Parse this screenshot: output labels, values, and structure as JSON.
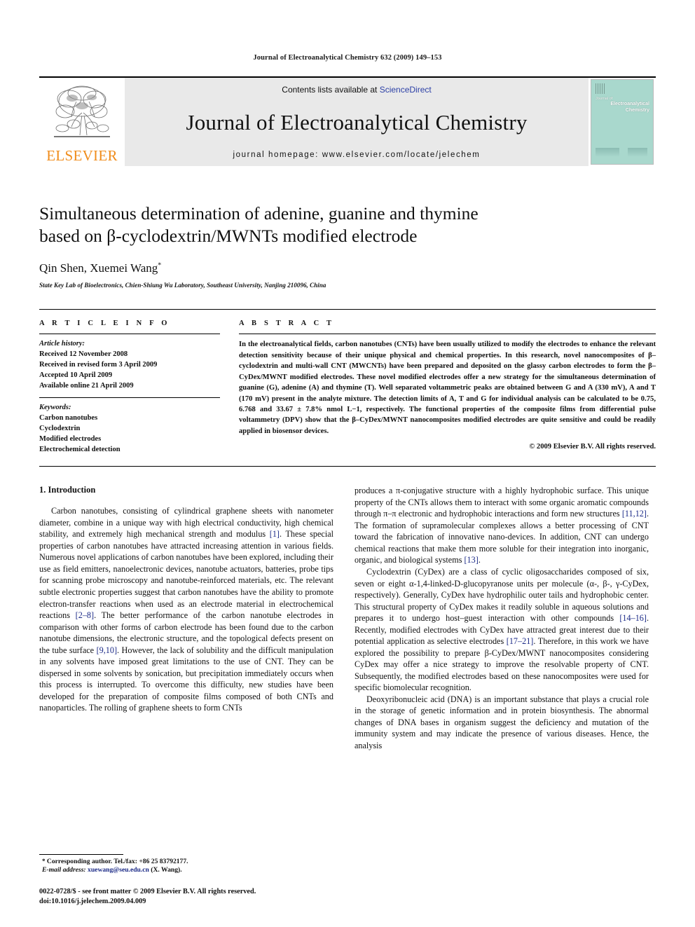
{
  "running_head": "Journal of Electroanalytical Chemistry 632 (2009) 149–153",
  "masthead": {
    "publisher_wordmark": "ELSEVIER",
    "contents_prefix": "Contents lists available at ",
    "contents_link": "ScienceDirect",
    "journal_title": "Journal of Electroanalytical Chemistry",
    "homepage_line": "journal homepage: www.elsevier.com/locate/jelechem",
    "cover": {
      "line1": "Journal of",
      "line2": "Electroanalytical",
      "line3": "Chemistry",
      "accent_color": "#a9d8cd"
    },
    "accent_color_elsevier": "#F08C1B",
    "link_color": "#2b3fa6",
    "panel_bg": "#e9e9e9"
  },
  "article": {
    "title_line_1": "Simultaneous determination of adenine, guanine and thymine",
    "title_line_2": "based on β-cyclodextrin/MWNTs modified electrode",
    "authors": "Qin Shen, Xuemei Wang",
    "corresponding_marker": "*",
    "affiliation": "State Key Lab of Bioelectronics, Chien-Shiung Wu Laboratory, Southeast University, Nanjing 210096, China"
  },
  "article_info": {
    "heading": "A R T I C L E   I N F O",
    "history_label": "Article history:",
    "history": [
      "Received 12 November 2008",
      "Received in revised form 3 April 2009",
      "Accepted 10 April 2009",
      "Available online 21 April 2009"
    ],
    "keywords_label": "Keywords:",
    "keywords": [
      "Carbon nanotubes",
      "Cyclodextrin",
      "Modified electrodes",
      "Electrochemical detection"
    ]
  },
  "abstract": {
    "heading": "A B S T R A C T",
    "text": "In the electroanalytical fields, carbon nanotubes (CNTs) have been usually utilized to modify the electrodes to enhance the relevant detection sensitivity because of their unique physical and chemical properties. In this research, novel nanocomposites of β–cyclodextrin and multi-wall CNT (MWCNTs) have been prepared and deposited on the glassy carbon electrodes to form the β–CyDex/MWNT modified electrodes. These novel modified electrodes offer a new strategy for the simultaneous determination of guanine (G), adenine (A) and thymine (T). Well separated voltammetric peaks are obtained between G and A (330 mV), A and T (170 mV) present in the analyte mixture. The detection limits of A, T and G for individual analysis can be calculated to be 0.75, 6.768 and 33.67 ± 7.8% nmol L−1, respectively. The functional properties of the composite films from differential pulse voltammetry (DPV) show that the β–CyDex/MWNT nanocomposites modified electrodes are quite sensitive and could be readily applied in biosensor devices.",
    "copyright": "© 2009 Elsevier B.V. All rights reserved."
  },
  "body": {
    "section_heading": "1. Introduction",
    "left_paragraphs": [
      {
        "parts": [
          {
            "t": "Carbon nanotubes, consisting of cylindrical graphene sheets with nanometer diameter, combine in a unique way with high electrical conductivity, high chemical stability, and extremely high mechanical strength and modulus "
          },
          {
            "t": "[1]",
            "ref": true
          },
          {
            "t": ". These special properties of carbon nanotubes have attracted increasing attention in various fields. Numerous novel applications of carbon nanotubes have been explored, including their use as field emitters, nanoelectronic devices, nanotube actuators, batteries, probe tips for scanning probe microscopy and nanotube-reinforced materials, etc. The relevant subtle electronic properties suggest that carbon nanotubes have the ability to promote electron-transfer reactions when used as an electrode material in electrochemical reactions "
          },
          {
            "t": "[2–8]",
            "ref": true
          },
          {
            "t": ". The better performance of the carbon nanotube electrodes in comparison with other forms of carbon electrode has been found due to the carbon nanotube dimensions, the electronic structure, and the topological defects present on the tube surface "
          },
          {
            "t": "[9,10]",
            "ref": true
          },
          {
            "t": ". However, the lack of solubility and the difficult manipulation in any solvents have imposed great limitations to the use of CNT. They can be dispersed in some solvents by sonication, but precipitation immediately occurs when this process is interrupted. To overcome this difficulty, new studies have been developed for the preparation of composite films composed of both CNTs and nanoparticles. The rolling of graphene sheets to form CNTs"
          }
        ]
      }
    ],
    "right_paragraphs": [
      {
        "indent": false,
        "parts": [
          {
            "t": "produces a π-conjugative structure with a highly hydrophobic surface. This unique property of the CNTs allows them to interact with some organic aromatic compounds through π–π electronic and hydrophobic interactions and form new structures "
          },
          {
            "t": "[11,12]",
            "ref": true
          },
          {
            "t": ". The formation of supramolecular complexes allows a better processing of CNT toward the fabrication of innovative nano-devices. In addition, CNT can undergo chemical reactions that make them more soluble for their integration into inorganic, organic, and biological systems "
          },
          {
            "t": "[13]",
            "ref": true
          },
          {
            "t": "."
          }
        ]
      },
      {
        "indent": true,
        "parts": [
          {
            "t": "Cyclodextrin (CyDex) are a class of cyclic oligosaccharides composed of six, seven or eight α-1,4-linked-D-glucopyranose units per molecule (α-, β-, γ-CyDex, respectively). Generally, CyDex have hydrophilic outer tails and hydrophobic center. This structural property of CyDex makes it readily soluble in aqueous solutions and prepares it to undergo host–guest interaction with other compounds "
          },
          {
            "t": "[14–16]",
            "ref": true
          },
          {
            "t": ". Recently, modified electrodes with CyDex have attracted great interest due to their potential application as selective electrodes "
          },
          {
            "t": "[17–21]",
            "ref": true
          },
          {
            "t": ". Therefore, in this work we have explored the possibility to prepare β-CyDex/MWNT nanocomposites considering CyDex may offer a nice strategy to improve the resolvable property of CNT. Subsequently, the modified electrodes based on these nanocomposites were used for specific biomolecular recognition."
          }
        ]
      },
      {
        "indent": true,
        "parts": [
          {
            "t": "Deoxyribonucleic acid (DNA) is an important substance that plays a crucial role in the storage of genetic information and in protein biosynthesis. The abnormal changes of DNA bases in organism suggest the deficiency and mutation of the immunity system and may indicate the presence of various diseases. Hence, the analysis"
          }
        ]
      }
    ]
  },
  "footnotes": {
    "corresponding": "Corresponding author. Tel./fax: +86 25 83792177.",
    "email_label": "E-mail address:",
    "email": "xuewang@seu.edu.cn",
    "email_suffix": "(X. Wang).",
    "link_color": "#1b2a87"
  },
  "imprint": {
    "line1": "0022-0728/$ - see front matter © 2009 Elsevier B.V. All rights reserved.",
    "line2": "doi:10.1016/j.jelechem.2009.04.009"
  }
}
